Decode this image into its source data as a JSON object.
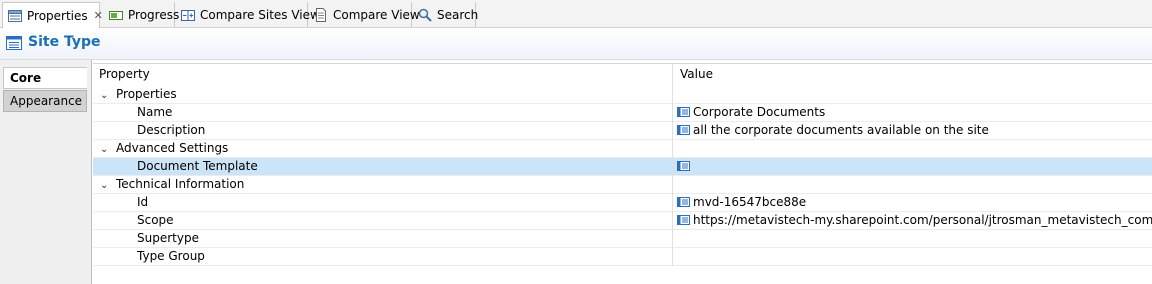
{
  "tabs": [
    {
      "label": "Properties",
      "icon": "properties-icon",
      "active": true
    },
    {
      "label": "Progress",
      "icon": "progress-icon"
    },
    {
      "label": "Compare Sites View",
      "icon": "compare-sites-icon"
    },
    {
      "label": "Compare View",
      "icon": "compare-view-icon"
    },
    {
      "label": "Search",
      "icon": "search-icon"
    }
  ],
  "header": {
    "title": "Site Type",
    "icon": "site-type-icon"
  },
  "side_tabs": {
    "core": "Core",
    "appearance": "Appearance"
  },
  "table": {
    "col_property": "Property",
    "col_value": "Value",
    "rows": [
      {
        "type": "group",
        "label": "Properties"
      },
      {
        "type": "item",
        "label": "Name",
        "value": "Corporate Documents",
        "has_icon": true
      },
      {
        "type": "item",
        "label": "Description",
        "value": "all the corporate documents available on the site",
        "has_icon": true
      },
      {
        "type": "group",
        "label": "Advanced Settings"
      },
      {
        "type": "item",
        "label": "Document Template",
        "value": "",
        "has_icon": true,
        "selected": true
      },
      {
        "type": "group",
        "label": "Technical Information"
      },
      {
        "type": "item",
        "label": "Id",
        "value": "mvd-16547bce88e",
        "has_icon": true
      },
      {
        "type": "item",
        "label": "Scope",
        "value": "https://metavistech-my.sharepoint.com/personal/jtrosman_metavistech_com",
        "has_icon": true
      },
      {
        "type": "item",
        "label": "Supertype",
        "value": "",
        "has_icon": false
      },
      {
        "type": "item",
        "label": "Type Group",
        "value": "",
        "has_icon": false
      }
    ]
  },
  "colors": {
    "title": "#1a6fb5",
    "selection": "#cce4f7",
    "accent": "#2a6ebf"
  }
}
